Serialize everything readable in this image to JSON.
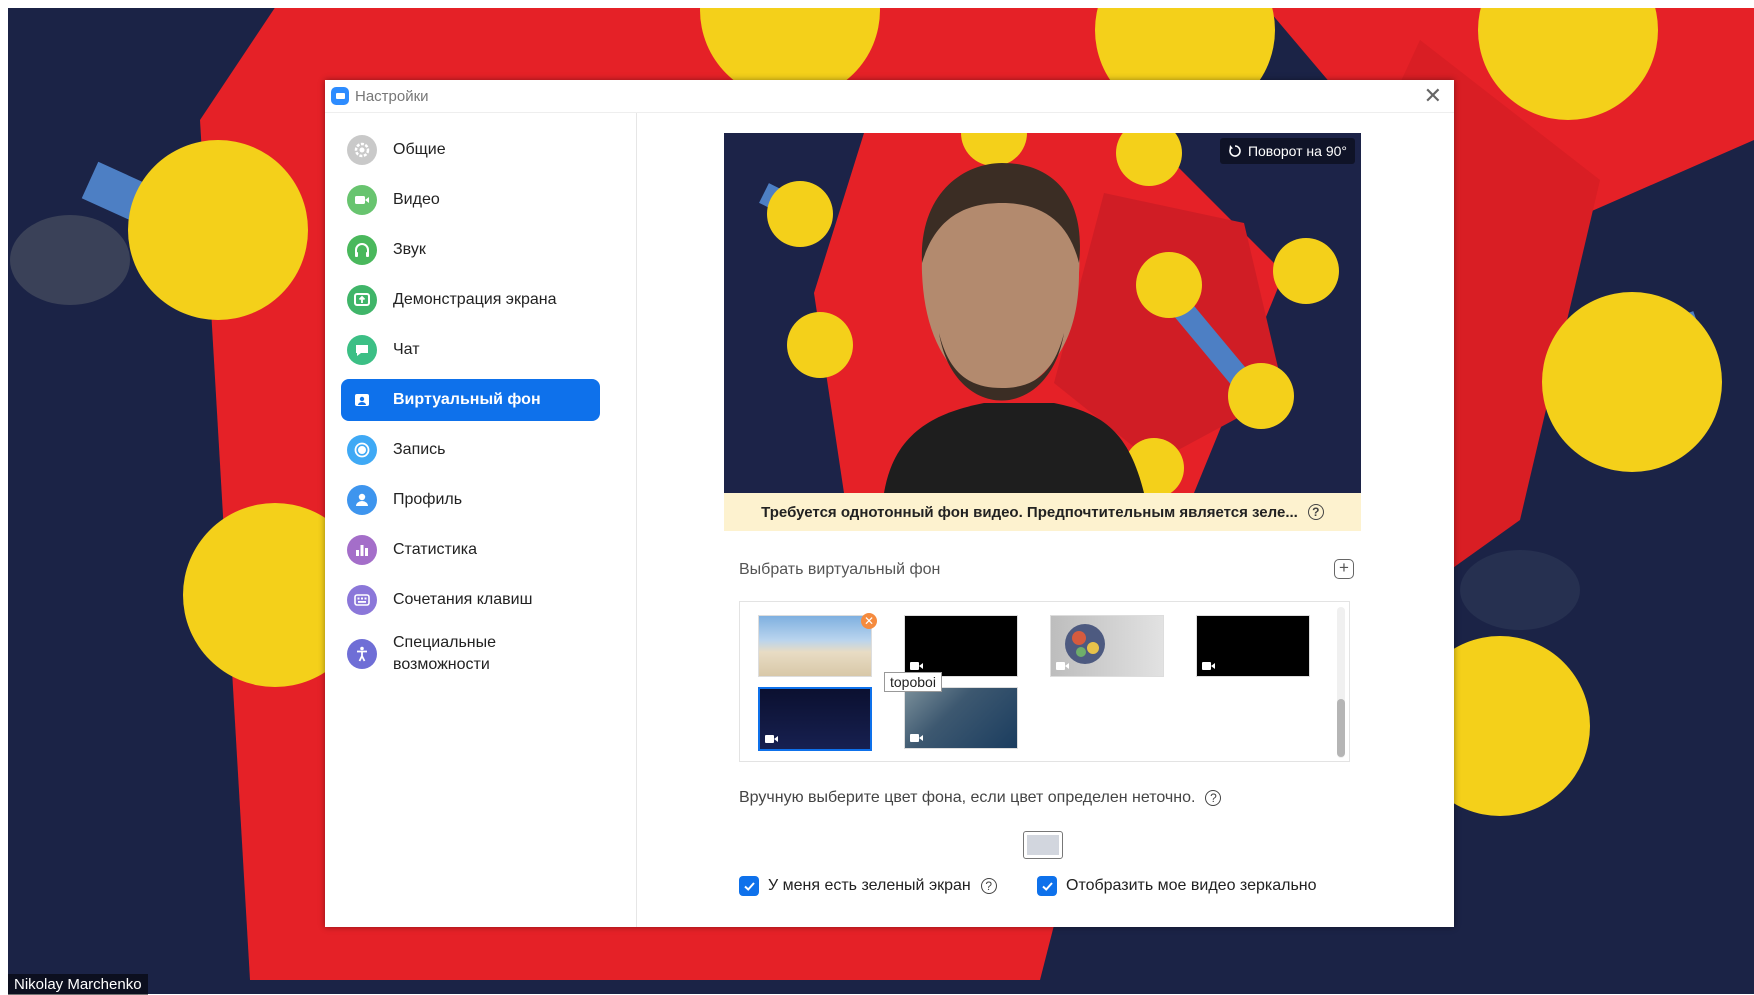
{
  "window": {
    "title": "Настройки"
  },
  "participant": {
    "name": "Nikolay Marchenko"
  },
  "sidebar": {
    "items": [
      {
        "label": "Общие",
        "icon": "gear-icon",
        "color": "#C9C9C9",
        "active": false
      },
      {
        "label": "Видео",
        "icon": "video-camera-icon",
        "color": "#68C46F",
        "active": false
      },
      {
        "label": "Звук",
        "icon": "headphones-icon",
        "color": "#4AB85C",
        "active": false
      },
      {
        "label": "Демонстрация экрана",
        "icon": "share-screen-icon",
        "color": "#40B569",
        "active": false
      },
      {
        "label": "Чат",
        "icon": "chat-bubble-icon",
        "color": "#3CBF85",
        "active": false
      },
      {
        "label": "Виртуальный фон",
        "icon": "virtual-background-icon",
        "color": "#0E71EB",
        "active": true
      },
      {
        "label": "Запись",
        "icon": "record-icon",
        "color": "#3FA9F5",
        "active": false
      },
      {
        "label": "Профиль",
        "icon": "profile-icon",
        "color": "#3E95EE",
        "active": false
      },
      {
        "label": "Статистика",
        "icon": "statistics-icon",
        "color": "#A46EC9",
        "active": false
      },
      {
        "label": "Сочетания клавиш",
        "icon": "keyboard-icon",
        "color": "#8B77D9",
        "active": false
      },
      {
        "label": "Специальные\nвозможности",
        "icon": "accessibility-icon",
        "color": "#6F6ED6",
        "active": false
      }
    ]
  },
  "preview": {
    "rotate_label": "Поворот на 90°"
  },
  "warning": {
    "text": "Требуется однотонный фон видео. Предпочтительным является зеле..."
  },
  "backgrounds": {
    "section_label": "Выбрать виртуальный фон",
    "tooltip": "topoboi",
    "selected_index": 4
  },
  "manual_color": {
    "label": "Вручную выберите цвет фона, если цвет определен неточно.",
    "color": "#d2d6de"
  },
  "options": {
    "green_screen": {
      "label": "У меня есть зеленый экран",
      "checked": true
    },
    "mirror": {
      "label": "Отобразить мое видео зеркально",
      "checked": true
    }
  },
  "colors": {
    "accent": "#0E71EB",
    "warning_bg": "#FDF2CF"
  }
}
